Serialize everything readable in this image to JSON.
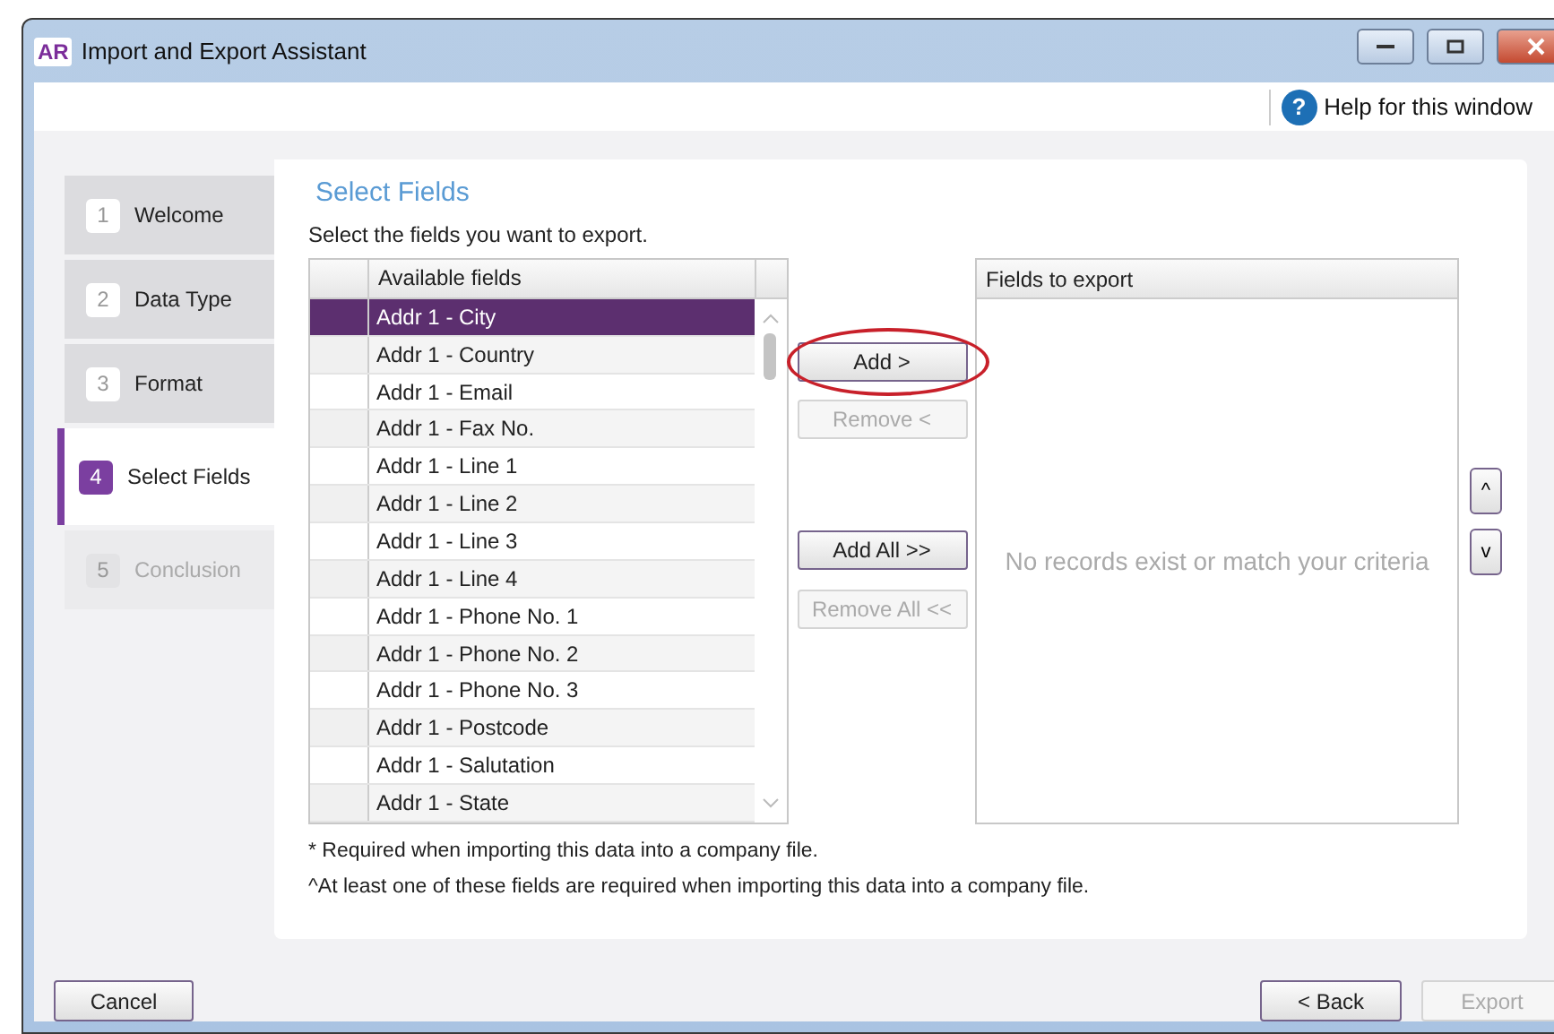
{
  "window": {
    "title": "Import and Export Assistant",
    "app_badge": "AR"
  },
  "help": {
    "label": "Help for this window",
    "icon": "?"
  },
  "steps": [
    {
      "number": "1",
      "label": "Welcome",
      "selected": false,
      "disabled": false
    },
    {
      "number": "2",
      "label": "Data Type",
      "selected": false,
      "disabled": false
    },
    {
      "number": "3",
      "label": "Format",
      "selected": false,
      "disabled": false
    },
    {
      "number": "4",
      "label": "Select Fields",
      "selected": true,
      "disabled": false
    },
    {
      "number": "5",
      "label": "Conclusion",
      "selected": false,
      "disabled": true
    }
  ],
  "panel": {
    "title": "Select Fields",
    "instruction": "Select the fields you want to export."
  },
  "available": {
    "header": "Available fields",
    "rows": [
      {
        "label": "Addr 1 - City",
        "selected": true
      },
      {
        "label": "Addr 1 - Country",
        "selected": false
      },
      {
        "label": "Addr 1 - Email",
        "selected": false
      },
      {
        "label": "Addr 1 - Fax No.",
        "selected": false
      },
      {
        "label": "Addr 1 - Line 1",
        "selected": false
      },
      {
        "label": "Addr 1 - Line 2",
        "selected": false
      },
      {
        "label": "Addr 1 - Line 3",
        "selected": false
      },
      {
        "label": "Addr 1 - Line 4",
        "selected": false
      },
      {
        "label": "Addr 1 - Phone No. 1",
        "selected": false
      },
      {
        "label": "Addr 1 - Phone No. 2",
        "selected": false
      },
      {
        "label": "Addr 1 - Phone No. 3",
        "selected": false
      },
      {
        "label": "Addr 1 - Postcode",
        "selected": false
      },
      {
        "label": "Addr 1 - Salutation",
        "selected": false
      },
      {
        "label": "Addr 1 - State",
        "selected": false
      }
    ]
  },
  "transfer_buttons": [
    {
      "label": "Add >",
      "disabled": false,
      "highlighted": true
    },
    {
      "label": "Remove <",
      "disabled": true,
      "highlighted": false
    },
    {
      "label": "Add All >>",
      "disabled": false,
      "highlighted": false
    },
    {
      "label": "Remove All <<",
      "disabled": true,
      "highlighted": false
    }
  ],
  "export_list": {
    "header": "Fields to export",
    "empty_message": "No records exist or match your criteria"
  },
  "order_buttons": [
    "^",
    "v"
  ],
  "footnotes": [
    "* Required when importing this data into a company file.",
    "^At least one of these fields are required when importing this data into a company file."
  ],
  "footer_buttons": [
    {
      "label": "Cancel",
      "disabled": false
    },
    {
      "label": "< Back",
      "disabled": false
    },
    {
      "label": "Export",
      "disabled": true
    }
  ]
}
